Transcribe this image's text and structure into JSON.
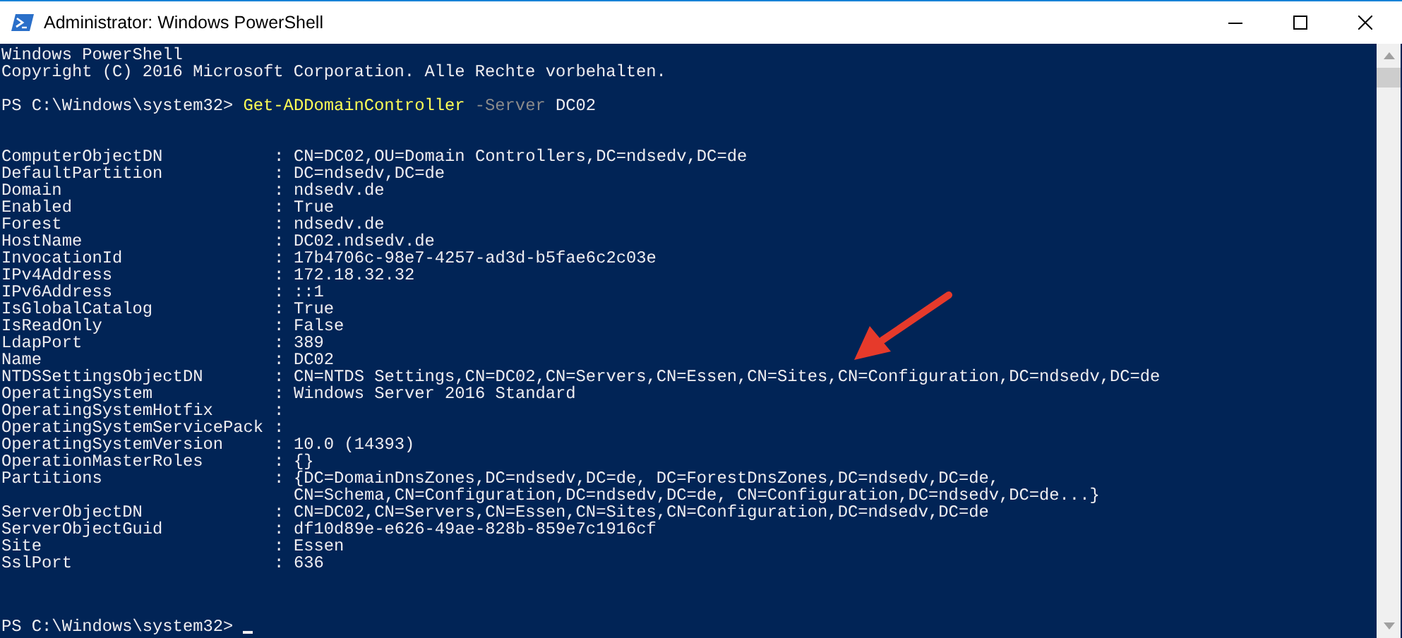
{
  "window": {
    "title": "Administrator: Windows PowerShell"
  },
  "banner": [
    "Windows PowerShell",
    "Copyright (C) 2016 Microsoft Corporation. Alle Rechte vorbehalten."
  ],
  "command": {
    "prompt": "PS C:\\Windows\\system32>",
    "cmdlet": "Get-ADDomainController",
    "parameter": "-Server",
    "argument": "DC02"
  },
  "properties": [
    {
      "name": "ComputerObjectDN",
      "colon": ":",
      "value": [
        "CN=DC02,OU=Domain Controllers,DC=ndsedv,DC=de"
      ]
    },
    {
      "name": "DefaultPartition",
      "colon": ":",
      "value": [
        "DC=ndsedv,DC=de"
      ]
    },
    {
      "name": "Domain",
      "colon": ":",
      "value": [
        "ndsedv.de"
      ]
    },
    {
      "name": "Enabled",
      "colon": ":",
      "value": [
        "True"
      ]
    },
    {
      "name": "Forest",
      "colon": ":",
      "value": [
        "ndsedv.de"
      ]
    },
    {
      "name": "HostName",
      "colon": ":",
      "value": [
        "DC02.ndsedv.de"
      ]
    },
    {
      "name": "InvocationId",
      "colon": ":",
      "value": [
        "17b4706c-98e7-4257-ad3d-b5fae6c2c03e"
      ]
    },
    {
      "name": "IPv4Address",
      "colon": ":",
      "value": [
        "172.18.32.32"
      ]
    },
    {
      "name": "IPv6Address",
      "colon": ":",
      "value": [
        "::1"
      ]
    },
    {
      "name": "IsGlobalCatalog",
      "colon": ":",
      "value": [
        "True"
      ]
    },
    {
      "name": "IsReadOnly",
      "colon": ":",
      "value": [
        "False"
      ]
    },
    {
      "name": "LdapPort",
      "colon": ":",
      "value": [
        "389"
      ]
    },
    {
      "name": "Name",
      "colon": ":",
      "value": [
        "DC02"
      ]
    },
    {
      "name": "NTDSSettingsObjectDN",
      "colon": ":",
      "value": [
        "CN=NTDS Settings,CN=DC02,CN=Servers,CN=Essen,CN=Sites,CN=Configuration,DC=ndsedv,DC=de"
      ]
    },
    {
      "name": "OperatingSystem",
      "colon": ":",
      "value": [
        "Windows Server 2016 Standard"
      ]
    },
    {
      "name": "OperatingSystemHotfix",
      "colon": ":"
    },
    {
      "name": "OperatingSystemServicePack",
      "colon": ":"
    },
    {
      "name": "OperatingSystemVersion",
      "colon": ":",
      "value": [
        "10.0 (14393)"
      ]
    },
    {
      "name": "OperationMasterRoles",
      "colon": ":",
      "value": [
        "{}"
      ]
    },
    {
      "name": "Partitions",
      "colon": ":",
      "value": [
        "{DC=DomainDnsZones,DC=ndsedv,DC=de, DC=ForestDnsZones,DC=ndsedv,DC=de,",
        "CN=Schema,CN=Configuration,DC=ndsedv,DC=de, CN=Configuration,DC=ndsedv,DC=de...}"
      ]
    },
    {
      "name": "ServerObjectDN",
      "colon": ":",
      "value": [
        "CN=DC02,CN=Servers,CN=Essen,CN=Sites,CN=Configuration,DC=ndsedv,DC=de"
      ]
    },
    {
      "name": "ServerObjectGuid",
      "colon": ":",
      "value": [
        "df10d89e-e626-49ae-828b-859e7c1916cf"
      ]
    },
    {
      "name": "Site",
      "colon": ":",
      "value": [
        "Essen"
      ]
    },
    {
      "name": "SslPort",
      "colon": ":",
      "value": [
        "636"
      ]
    }
  ],
  "final_prompt": {
    "prompt": "PS C:\\Windows\\system32>",
    "cursor": true
  },
  "annotation": {
    "kind": "arrow"
  }
}
